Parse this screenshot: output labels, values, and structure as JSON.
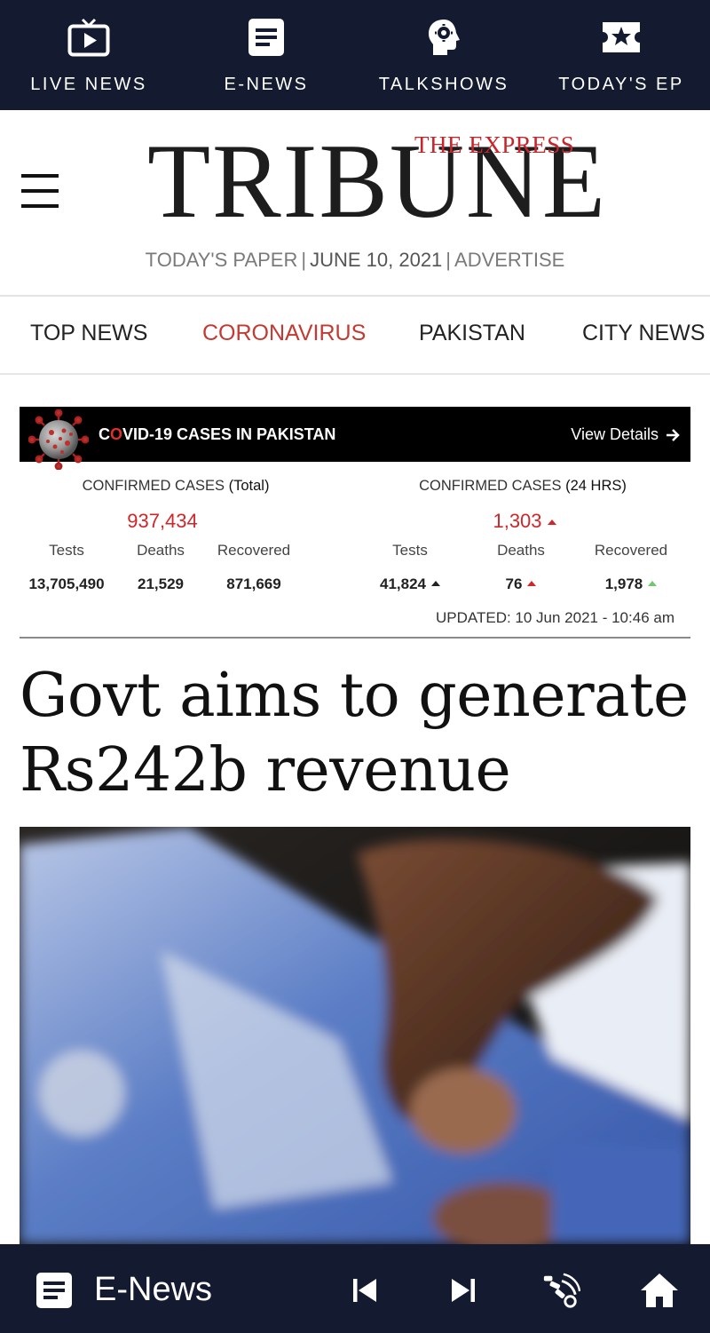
{
  "top_nav": {
    "items": [
      {
        "label": "LIVE NEWS",
        "icon": "tv-icon"
      },
      {
        "label": "E-NEWS",
        "icon": "document-icon"
      },
      {
        "label": "TALKSHOWS",
        "icon": "head-gear-icon"
      },
      {
        "label": "TODAY'S EP",
        "icon": "ticket-star-icon"
      }
    ]
  },
  "masthead": {
    "logo_top": "THE EXPRESS",
    "logo_main": "TRIBUNE",
    "todays_paper": "TODAY'S PAPER",
    "date": "JUNE 10, 2021",
    "advertise": "ADVERTISE",
    "separator": "|"
  },
  "categories": [
    "TOP NEWS",
    "CORONAVIRUS",
    "PAKISTAN",
    "CITY NEWS"
  ],
  "active_category": "CORONAVIRUS",
  "covid": {
    "title_first": "C",
    "title_o": "O",
    "title_rest": "VID-19 CASES IN PAKISTAN",
    "view_details": "View Details",
    "total": {
      "heading": "CONFIRMED CASES",
      "heading_sub": "(Total)",
      "confirmed": "937,434",
      "tests_label": "Tests",
      "deaths_label": "Deaths",
      "recovered_label": "Recovered",
      "tests": "13,705,490",
      "deaths": "21,529",
      "recovered": "871,669"
    },
    "daily": {
      "heading": "CONFIRMED CASES",
      "heading_sub": "(24 HRS)",
      "confirmed": "1,303",
      "tests_label": "Tests",
      "deaths_label": "Deaths",
      "recovered_label": "Recovered",
      "tests": "41,824",
      "deaths": "76",
      "recovered": "1,978"
    },
    "updated": "UPDATED: 10 Jun 2021 - 10:46 am"
  },
  "article": {
    "headline": "Govt aims to generate Rs242b revenue"
  },
  "bottom_bar": {
    "enews_label": "E-News"
  },
  "colors": {
    "nav_bg": "#141b31",
    "accent_red": "#c23a32",
    "up_green": "#6ec86f"
  }
}
